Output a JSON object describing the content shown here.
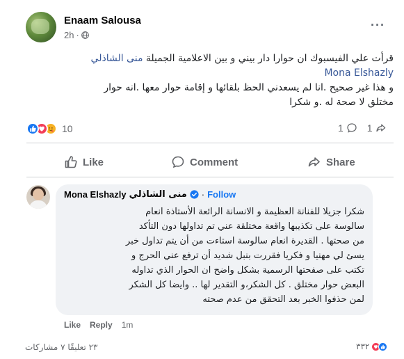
{
  "post": {
    "author": "Enaam Salousa",
    "time": "2h",
    "more_label": "···",
    "text_line1": "قرأت علي الفيسبوك ان حوارا دار  بيني و بين الاعلامية الجميلة",
    "mention_ar": "منى الشاذلي",
    "mention_en": "Mona Elshazly",
    "text_line3": "و هذا غير صحيح .انا لم يسعدني الحظ بلقائها  و إقامة حوار معها .انه حوار",
    "text_line4": "مختلق لا صحة له .و شكرا"
  },
  "reactions": {
    "count": "10",
    "comments_count": "1",
    "shares_count": "1"
  },
  "actions": {
    "like": "Like",
    "comment": "Comment",
    "share": "Share"
  },
  "comment": {
    "author_en": "Mona Elshazly",
    "author_ar": "منى الشاذلي",
    "separator": "·",
    "follow": "Follow",
    "lines": [
      "شكرا جزيلا للفنانة العظيمة و الانسانة الرائعة الأستاذة انعام",
      "سالوسة على تكذيبها واقعة مختلقة عني تم تداولها دون التأكد",
      "من صحتها . القديرة انعام سالوسة استاءت من أن يتم تداول خبر",
      "يسئ لي مهنيا و فكريا فقررت بنبل شديد أن ترفع عني الحرج و",
      "تكتب على صفحتها الرسمية بشكل واضح ان الحوار الذي تداوله",
      "البعض حوار مختلق . كل الشكر،و التقدير لها .. وايضا كل الشكر",
      "لمن حذفوا الخبر بعد التحقق من عدم صحته"
    ],
    "like": "Like",
    "reply": "Reply",
    "time": "1m"
  },
  "footer": {
    "left": "٢٣ تعليقًا  ٧ مشاركات",
    "right_count": "٣٣٢"
  },
  "colors": {
    "like_blue": "#1877f2",
    "love_red": "#f33e58",
    "care_yellow": "#f7b125",
    "mention": "#385898",
    "muted": "#65676b"
  }
}
